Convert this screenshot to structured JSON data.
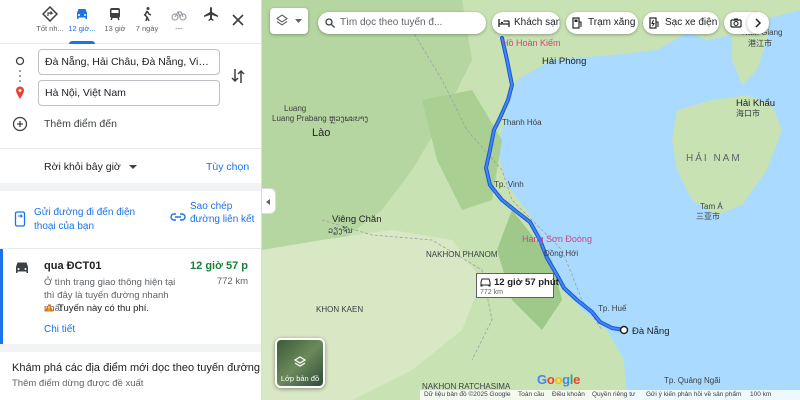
{
  "travel_modes": [
    {
      "label": "Tốt nh...",
      "icon": "best-route-icon"
    },
    {
      "label": "12 giờ...",
      "icon": "car-icon"
    },
    {
      "label": "13 giờ",
      "icon": "transit-icon"
    },
    {
      "label": "7 ngày",
      "icon": "walk-icon"
    },
    {
      "label": "---",
      "icon": "bicycle-icon"
    },
    {
      "label": "",
      "icon": "flight-icon"
    }
  ],
  "waypoints": {
    "origin": "Đà Nẵng, Hải Châu, Đà Nẵng, Việt Nam",
    "destination": "Hà Nội, Việt Nam",
    "add_destination": "Thêm điểm đến"
  },
  "depart": {
    "label": "Rời khỏi bây giờ",
    "options": "Tùy chọn"
  },
  "share": {
    "send_to_phone": "Gửi đường đi đến điện thoại của bạn",
    "copy_link": "Sao chép đường liên kết"
  },
  "route": {
    "name": "qua ĐCT01",
    "time": "12 giờ 57 p",
    "distance": "772 km",
    "description": "Ở tình trạng giao thông hiện tại thì đây là tuyến đường nhanh nhất",
    "toll": "Tuyến này có thu phí.",
    "details": "Chi tiết"
  },
  "explore": {
    "title": "Khám phá các địa điểm mới dọc theo tuyến đường",
    "subtitle": "Thêm điểm dừng được đề xuất"
  },
  "map": {
    "search_placeholder": "Tìm dọc theo tuyến đ...",
    "chips": [
      "Khách sạn",
      "Trạm xăng",
      "Sạc xe điện",
      ""
    ],
    "bubble_time": "12 giờ 57 phút",
    "bubble_distance": "772 km",
    "layer_label": "Lớp bản đồ",
    "labels": {
      "ho_hoan_kiem": "Hồ Hoàn Kiếm",
      "hai_phong": "Hải Phòng",
      "lao": "Lào",
      "luang_prabang": "Luang Prabang ຫຼວງພະບາງ",
      "luang": "Luang",
      "thanh_hoa": "Thanh Hóa",
      "vinh": "Tp. Vinh",
      "vieng_chan": "Viêng Chăn",
      "vieng_chan_lao": "ວຽງຈັນ",
      "nakhon_phanom": "NAKHON PHANOM",
      "hang_son_doong": "Hang Sơn Đoòng",
      "dong_hoi": "Đồng Hới",
      "hue": "Tp. Huế",
      "da_nang": "Đà Nẵng",
      "khon_kaen": "KHON KAEN",
      "nakhon_ratchasima": "NAKHON RATCHASIMA",
      "hai_khau": "Hải Khẩu",
      "hai_khau_cn": "海口市",
      "hai_nam": "HẢI NAM",
      "tam_a": "Tam Á",
      "tam_a_cn": "三亚市",
      "nam_giang": "Nam Giang",
      "nam_giang_cn": "港江市",
      "quang_ngai": "Tp. Quảng Ngãi"
    },
    "footer": [
      "Dữ liệu bản đồ ©2025 Google",
      "Toàn cầu",
      "Điều khoản",
      "Quyền riêng tư",
      "Gửi ý kiến phản hồi về sản phẩm",
      "100 km"
    ]
  },
  "colors": {
    "accent": "#1a73e8",
    "route": "#1a73e8",
    "time_green": "#188038",
    "water": "#aadaff",
    "land": "#c3dfb6"
  }
}
